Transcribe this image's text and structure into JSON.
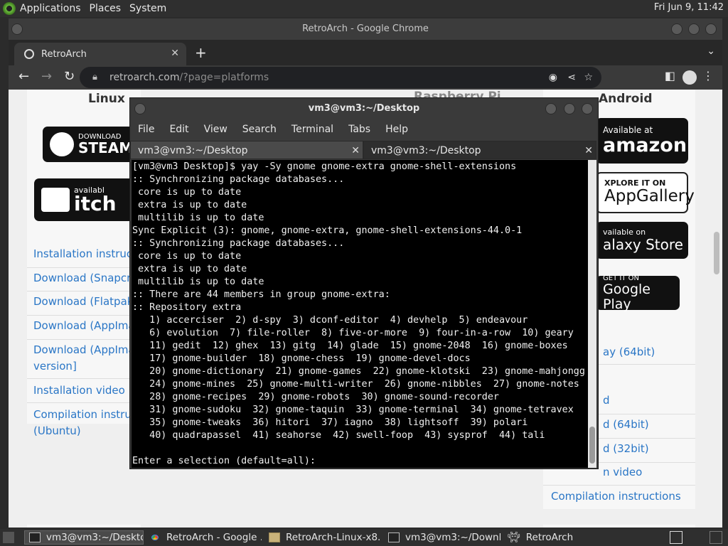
{
  "top_panel": {
    "menus": [
      "Applications",
      "Places",
      "System"
    ],
    "clock": "Fri Jun  9, 11:42"
  },
  "chrome": {
    "window_title": "RetroArch - Google Chrome",
    "tab_title": "RetroArch",
    "url_host": "retroarch.com",
    "url_path": "/?page=platforms"
  },
  "webpage": {
    "linux": {
      "title": "Linux",
      "steam_badge_top": "DOWNLOAD",
      "steam_badge_main": "STEAM",
      "itch_badge_top": "availabl",
      "itch_badge_main": "itch",
      "links": [
        "Installation instructi",
        "Download (Snapcra",
        "Download (Flatpak)",
        "Download (AppIma",
        "Download (AppIma",
        "version]",
        "Installation video",
        "Compilation instruc",
        "(Ubuntu)"
      ]
    },
    "rpi_title": "Raspberry Pi",
    "android": {
      "title": "Android",
      "amazon_top": "Available at",
      "amazon_main": "amazon",
      "appgallery_top": "XPLORE IT ON",
      "appgallery_main": "AppGallery",
      "galaxy_top": "vailable on",
      "galaxy_main": "alaxy Store",
      "gplay_top": "GET IT ON",
      "gplay_main": "Google Play",
      "links": [
        "ay (64bit)",
        "d",
        "d (64bit)",
        "d (32bit)",
        "n video",
        "Compilation instructions"
      ]
    }
  },
  "terminal": {
    "title": "vm3@vm3:~/Desktop",
    "menus": [
      "File",
      "Edit",
      "View",
      "Search",
      "Terminal",
      "Tabs",
      "Help"
    ],
    "tabs": [
      "vm3@vm3:~/Desktop",
      "vm3@vm3:~/Desktop"
    ],
    "lines": [
      "[vm3@vm3 Desktop]$ yay -Sy gnome gnome-extra gnome-shell-extensions",
      ":: Synchronizing package databases...",
      " core is up to date",
      " extra is up to date",
      " multilib is up to date",
      "Sync Explicit (3): gnome, gnome-extra, gnome-shell-extensions-44.0-1",
      ":: Synchronizing package databases...",
      " core is up to date",
      " extra is up to date",
      " multilib is up to date",
      ":: There are 44 members in group gnome-extra:",
      ":: Repository extra",
      "   1) accerciser  2) d-spy  3) dconf-editor  4) devhelp  5) endeavour",
      "   6) evolution  7) file-roller  8) five-or-more  9) four-in-a-row  10) geary",
      "   11) gedit  12) ghex  13) gitg  14) glade  15) gnome-2048  16) gnome-boxes",
      "   17) gnome-builder  18) gnome-chess  19) gnome-devel-docs",
      "   20) gnome-dictionary  21) gnome-games  22) gnome-klotski  23) gnome-mahjongg",
      "   24) gnome-mines  25) gnome-multi-writer  26) gnome-nibbles  27) gnome-notes",
      "   28) gnome-recipes  29) gnome-robots  30) gnome-sound-recorder",
      "   31) gnome-sudoku  32) gnome-taquin  33) gnome-terminal  34) gnome-tetravex",
      "   35) gnome-tweaks  36) hitori  37) iagno  38) lightsoff  39) polari",
      "   40) quadrapassel  41) seahorse  42) swell-foop  43) sysprof  44) tali",
      "",
      "Enter a selection (default=all): "
    ]
  },
  "taskbar": {
    "items": [
      {
        "label": "vm3@vm3:~/Desktop",
        "icon": "terminal-icon"
      },
      {
        "label": "RetroArch - Google ...",
        "icon": "chrome-icon"
      },
      {
        "label": "RetroArch-Linux-x8...",
        "icon": "folder-icon"
      },
      {
        "label": "vm3@vm3:~/Downl...",
        "icon": "terminal-icon"
      },
      {
        "label": "RetroArch",
        "icon": "retroarch-icon"
      }
    ]
  }
}
